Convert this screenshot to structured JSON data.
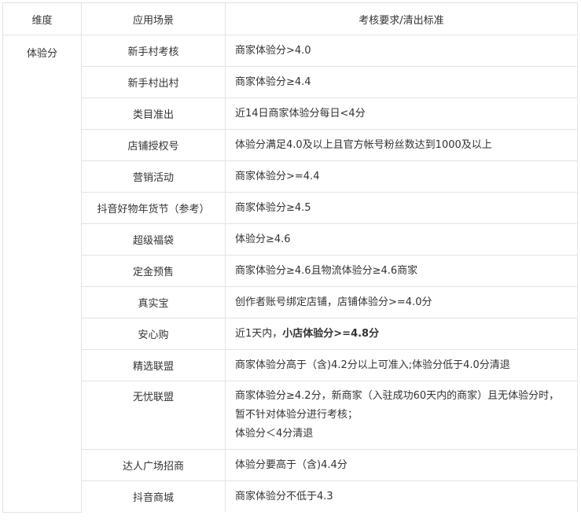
{
  "headers": {
    "dimension": "维度",
    "scenario": "应用场景",
    "requirement": "考核要求/清出标准"
  },
  "dimension": "体验分",
  "rows": [
    {
      "scenario": "新手村考核",
      "requirement": "商家体验分>4.0"
    },
    {
      "scenario": "新手村出村",
      "requirement": "商家体验分≥4.4"
    },
    {
      "scenario": "类目准出",
      "requirement": "近14日商家体验分每日<4分"
    },
    {
      "scenario": "店铺授权号",
      "requirement": "体验分满足4.0及以上且官方帐号粉丝数达到1000及以上"
    },
    {
      "scenario": "营销活动",
      "requirement": "商家体验分>=4.4"
    },
    {
      "scenario": "抖音好物年货节（参考）",
      "requirement": "商家体验分≥4.5"
    },
    {
      "scenario": "超级福袋",
      "requirement": "体验分≥4.6"
    },
    {
      "scenario": "定金预售",
      "requirement": "商家体验分≥4.6且物流体验分≥4.6商家"
    },
    {
      "scenario": "真实宝",
      "requirement": "创作者账号绑定店铺，店铺体验分>=4.0分"
    },
    {
      "scenario": "安心购",
      "requirement_prefix": "近1天内，",
      "requirement_bold": "小店体验分>=4.8分"
    },
    {
      "scenario": "精选联盟",
      "requirement": "商家体验分高于（含)4.2分以上可准入;体验分低于4.0分清退"
    },
    {
      "scenario": "无忧联盟",
      "requirement_line1": "商家体验分≥4.2分，新商家（入驻成功60天内的商家）且无体验分时，暂不针对体验分进行考核；",
      "requirement_line2": "体验分＜4分清退"
    },
    {
      "scenario": "达人广场招商",
      "requirement": "体验分要高于（含)4.4分"
    },
    {
      "scenario": "抖音商城",
      "requirement": "商家体验分不低于4.3"
    }
  ]
}
